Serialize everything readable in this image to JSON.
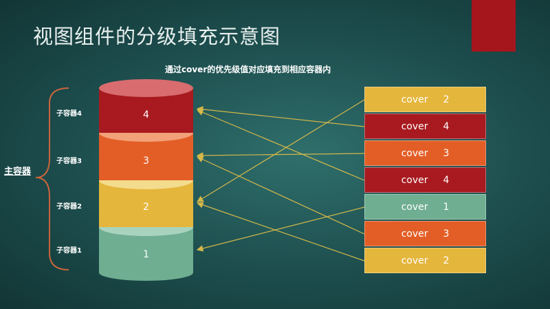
{
  "title": "视图组件的分级填充示意图",
  "subtitle": "通过cover的优先级值对应填充到相应容器内",
  "main_container_label": "主容器",
  "sub_containers": [
    {
      "label": "子容器4",
      "number": "4",
      "color": "#a81a1f",
      "top_color": "#d86c6f"
    },
    {
      "label": "子容器3",
      "number": "3",
      "color": "#e35e26",
      "top_color": "#f2a179"
    },
    {
      "label": "子容器2",
      "number": "2",
      "color": "#e5b63c",
      "top_color": "#f3dc8e"
    },
    {
      "label": "子容器1",
      "number": "1",
      "color": "#6fae91",
      "top_color": "#a8d3be"
    }
  ],
  "covers": [
    {
      "name": "cover",
      "priority": "2",
      "color": "#e5b63c"
    },
    {
      "name": "cover",
      "priority": "4",
      "color": "#a81a1f"
    },
    {
      "name": "cover",
      "priority": "3",
      "color": "#e35e26"
    },
    {
      "name": "cover",
      "priority": "4",
      "color": "#a81a1f"
    },
    {
      "name": "cover",
      "priority": "1",
      "color": "#6fae91"
    },
    {
      "name": "cover",
      "priority": "3",
      "color": "#e35e26"
    },
    {
      "name": "cover",
      "priority": "2",
      "color": "#e5b63c"
    }
  ],
  "arrow_color": "#d4b84a",
  "bracket_color": "#c9653c",
  "accent_color": "#a4161c"
}
